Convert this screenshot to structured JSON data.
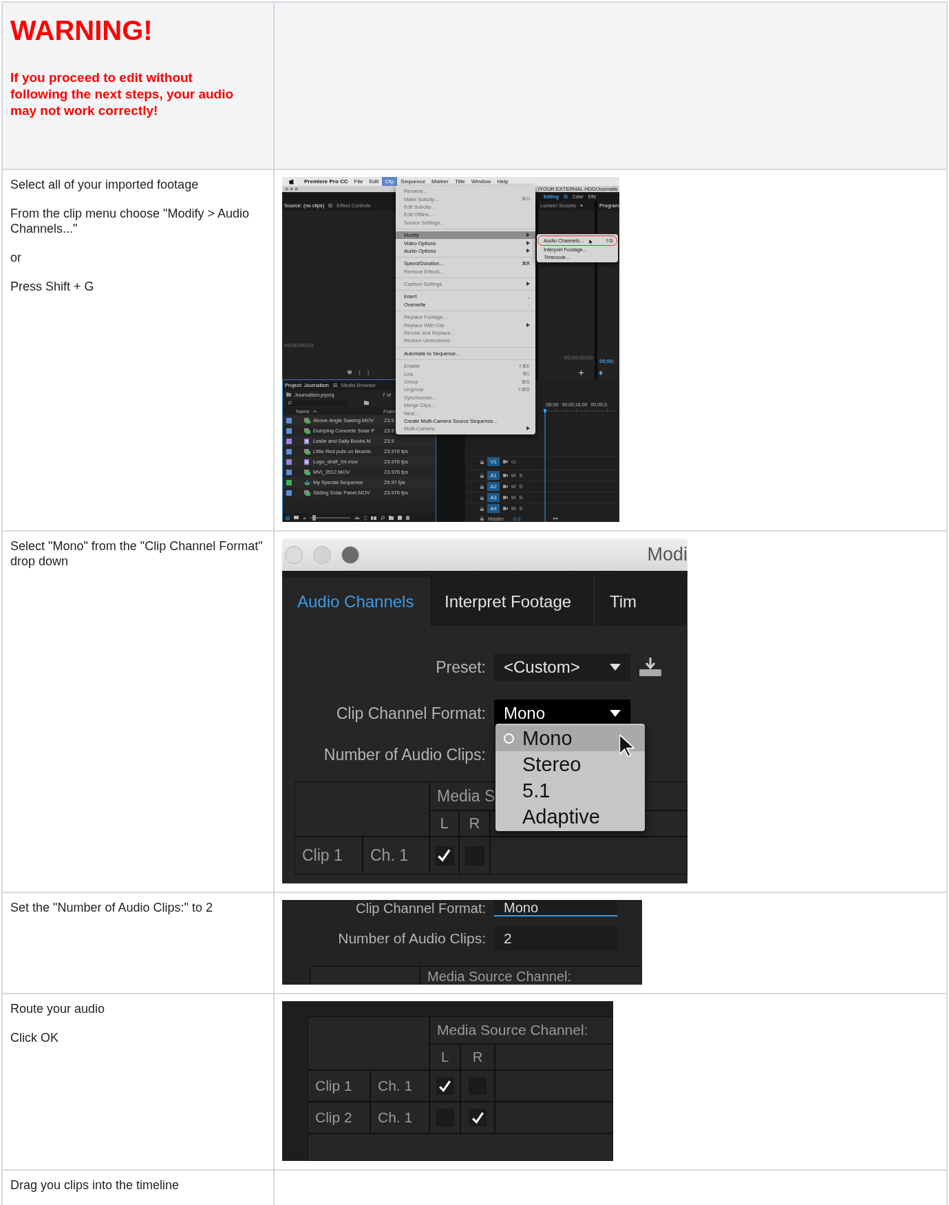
{
  "warning": {
    "title": "WARNING!",
    "message": "If you proceed to edit without following the next steps, your audio may not work correctly!"
  },
  "steps": [
    {
      "text": [
        "Select all of your imported footage",
        "From the clip menu choose \"Modify > Audio Channels...\"",
        "or",
        "Press Shift + G"
      ],
      "screenshot": {
        "kind": "premiere_clip_menu",
        "menubar": [
          {
            "label": "Premiere Pro CC",
            "kind": "app",
            "selected": false
          },
          {
            "label": "File",
            "kind": "menu",
            "selected": false
          },
          {
            "label": "Edit",
            "kind": "menu",
            "selected": false
          },
          {
            "label": "Clip",
            "kind": "menu",
            "selected": true
          },
          {
            "label": "Sequence",
            "kind": "menu",
            "selected": false
          },
          {
            "label": "Marker",
            "kind": "menu",
            "selected": false
          },
          {
            "label": "Title",
            "kind": "menu",
            "selected": false
          },
          {
            "label": "Window",
            "kind": "menu",
            "selected": false
          },
          {
            "label": "Help",
            "kind": "menu",
            "selected": false
          }
        ],
        "path": "/YOUR EXTERNAL HDD/Journalis",
        "workspaces": [
          {
            "label": "Editing",
            "selected": true
          },
          {
            "label": "Color",
            "selected": false
          },
          {
            "label": "Effe",
            "selected": false
          }
        ],
        "source_panel": {
          "tabs": [
            {
              "label": "Source: (no clips)",
              "selected": true
            },
            {
              "label": "Effect Controls",
              "selected": false
            }
          ],
          "timecode": "00;00;00;00",
          "controls": [
            "{",
            "}"
          ]
        },
        "scopes_panel": {
          "tab": "Lumetri Scopes",
          "more": "»",
          "timecode": "00;00;00;00"
        },
        "program_panel": {
          "tab": "Program",
          "timecode": "00;00;"
        },
        "project_panel": {
          "tabs": [
            {
              "label": "Project: Journalism",
              "selected": true
            },
            {
              "label": "Media Browser",
              "selected": false
            }
          ],
          "file": "Journalism.prproj",
          "count": "7 of",
          "columns": [
            "Name",
            "Fram"
          ],
          "items": [
            {
              "name": "Above Angle Sawing.MOV",
              "rate": "23.9",
              "color": "#5b8fd6",
              "kind": "clip"
            },
            {
              "name": "Dumping Concrete Solar P",
              "rate": "23.9",
              "color": "#5b8fd6",
              "kind": "clip"
            },
            {
              "name": "Leslie and Sally  Books.M",
              "rate": "23.9",
              "color": "#9b82e0",
              "kind": "still"
            },
            {
              "name": "Little Red puts on Beanie.",
              "rate": "23.976 fps",
              "color": "#5b8fd6",
              "kind": "clip"
            },
            {
              "name": "Logo_draft_04.mov",
              "rate": "23.976 fps",
              "color": "#9b82e0",
              "kind": "still"
            },
            {
              "name": "MVI_3512.MOV",
              "rate": "23.976 fps",
              "color": "#5b8fd6",
              "kind": "clip"
            },
            {
              "name": "My Special Sequence",
              "rate": "29.97 fps",
              "color": "#3fb34f",
              "kind": "sequence"
            },
            {
              "name": "Sliding Solar Panel.MOV",
              "rate": "23.976 fps",
              "color": "#5b8fd6",
              "kind": "clip"
            }
          ],
          "zoom_slider": {
            "level": 0.05
          }
        },
        "timeline": {
          "ruler": [
            ";00;00",
            "00;00;16;00",
            "00;00;3"
          ],
          "tracks": [
            {
              "name": "V1",
              "kind": "video"
            },
            {
              "name": "A1",
              "kind": "audio",
              "buttons": [
                "M",
                "S"
              ]
            },
            {
              "name": "A2",
              "kind": "audio",
              "buttons": [
                "M",
                "S"
              ]
            },
            {
              "name": "A3",
              "kind": "audio",
              "buttons": [
                "M",
                "S"
              ]
            },
            {
              "name": "A4",
              "kind": "audio",
              "buttons": [
                "M",
                "S"
              ]
            }
          ],
          "master": {
            "label": "Master",
            "value": "0.0"
          }
        },
        "clip_menu": [
          [
            {
              "label": "Rename...",
              "disabled": true,
              "selected": false,
              "submenu": false
            },
            {
              "label": "Make Subclip...",
              "shortcut": "⌘U",
              "disabled": true,
              "selected": false,
              "submenu": false
            },
            {
              "label": "Edit Subclip...",
              "disabled": true,
              "selected": false,
              "submenu": false
            },
            {
              "label": "Edit Offline...",
              "disabled": true,
              "selected": false,
              "submenu": false
            },
            {
              "label": "Source Settings...",
              "disabled": true,
              "selected": false,
              "submenu": false
            }
          ],
          [
            {
              "label": "Modify",
              "disabled": false,
              "selected": true,
              "submenu": true
            },
            {
              "label": "Video Options",
              "disabled": false,
              "selected": false,
              "submenu": true
            },
            {
              "label": "Audio Options",
              "disabled": false,
              "selected": false,
              "submenu": true
            }
          ],
          [
            {
              "label": "Speed/Duration...",
              "shortcut": "⌘R",
              "disabled": false,
              "selected": false,
              "submenu": false
            },
            {
              "label": "Remove Effects...",
              "disabled": true,
              "selected": false,
              "submenu": false
            }
          ],
          [
            {
              "label": "Capture Settings",
              "disabled": true,
              "selected": false,
              "submenu": true
            }
          ],
          [
            {
              "label": "Insert",
              "shortcut": ",",
              "disabled": false,
              "selected": false,
              "submenu": false
            },
            {
              "label": "Overwrite",
              "shortcut": ".",
              "disabled": false,
              "selected": false,
              "submenu": false
            }
          ],
          [
            {
              "label": "Replace Footage...",
              "disabled": true,
              "selected": false,
              "submenu": false
            },
            {
              "label": "Replace With Clip",
              "disabled": true,
              "selected": false,
              "submenu": true
            },
            {
              "label": "Render and Replace...",
              "disabled": true,
              "selected": false,
              "submenu": false
            },
            {
              "label": "Restore Unrendered",
              "disabled": true,
              "selected": false,
              "submenu": false
            }
          ],
          [
            {
              "label": "Automate to Sequence...",
              "disabled": false,
              "selected": false,
              "submenu": false
            }
          ],
          [
            {
              "label": "Enable",
              "shortcut": "⇧⌘E",
              "disabled": true,
              "selected": false,
              "submenu": false
            },
            {
              "label": "Link",
              "shortcut": "⌘L",
              "disabled": true,
              "selected": false,
              "submenu": false
            },
            {
              "label": "Group",
              "shortcut": "⌘G",
              "disabled": true,
              "selected": false,
              "submenu": false
            },
            {
              "label": "Ungroup",
              "shortcut": "⇧⌘G",
              "disabled": true,
              "selected": false,
              "submenu": false
            },
            {
              "label": "Synchronize...",
              "disabled": true,
              "selected": false,
              "submenu": false
            },
            {
              "label": "Merge Clips...",
              "disabled": true,
              "selected": false,
              "submenu": false
            },
            {
              "label": "Nest...",
              "disabled": true,
              "selected": false,
              "submenu": false
            },
            {
              "label": "Create Multi-Camera Source Sequence...",
              "disabled": false,
              "selected": false,
              "submenu": false
            },
            {
              "label": "Multi-Camera",
              "disabled": true,
              "selected": false,
              "submenu": true
            }
          ]
        ],
        "submenu": [
          {
            "label": "Audio Channels...",
            "shortcut": "⇧G",
            "circled": true
          },
          {
            "label": "Interpret Footage...",
            "circled": false
          },
          {
            "label": "Timecode...",
            "circled": false
          }
        ]
      }
    },
    {
      "text": [
        "Select \"Mono\" from the \"Clip Channel Format\" drop down"
      ],
      "screenshot": {
        "kind": "modify_dialog",
        "title": "Modi",
        "tabs": [
          {
            "label": "Audio Channels",
            "selected": true
          },
          {
            "label": "Interpret Footage",
            "selected": false
          },
          {
            "label": "Tim",
            "selected": false
          }
        ],
        "preset": {
          "label": "Preset:",
          "value": "<Custom>"
        },
        "channel_format": {
          "label": "Clip Channel Format:",
          "value": "Mono",
          "options": [
            {
              "label": "Mono",
              "selected": true
            },
            {
              "label": "Stereo",
              "selected": false
            },
            {
              "label": "5.1",
              "selected": false
            },
            {
              "label": "Adaptive",
              "selected": false
            }
          ]
        },
        "audio_clips": {
          "label": "Number of Audio Clips:"
        },
        "table": {
          "header": "Media S",
          "channels": [
            "L",
            "R"
          ],
          "rows": [
            {
              "clip": "Clip 1",
              "channel": "Ch. 1",
              "left": true,
              "right": false
            }
          ]
        }
      }
    },
    {
      "text": [
        "Set the \"Number of Audio Clips:\" to 2"
      ],
      "screenshot": {
        "kind": "audio_clips_setting",
        "channel_format": {
          "label": "Clip Channel Format:",
          "value": "Mono"
        },
        "audio_clips": {
          "label": "Number of Audio Clips:",
          "value": "2"
        },
        "table_header": "Media Source Channel:"
      }
    },
    {
      "text": [
        "Route your audio",
        "Click OK"
      ],
      "screenshot": {
        "kind": "channel_routing",
        "table": {
          "header": "Media Source Channel:",
          "channels": [
            "L",
            "R"
          ],
          "rows": [
            {
              "clip": "Clip 1",
              "channel": "Ch. 1",
              "left": true,
              "right": false
            },
            {
              "clip": "Clip 2",
              "channel": "Ch. 1",
              "left": false,
              "right": true
            }
          ]
        }
      }
    },
    {
      "text": [
        "Drag you clips into the timeline"
      ]
    }
  ]
}
